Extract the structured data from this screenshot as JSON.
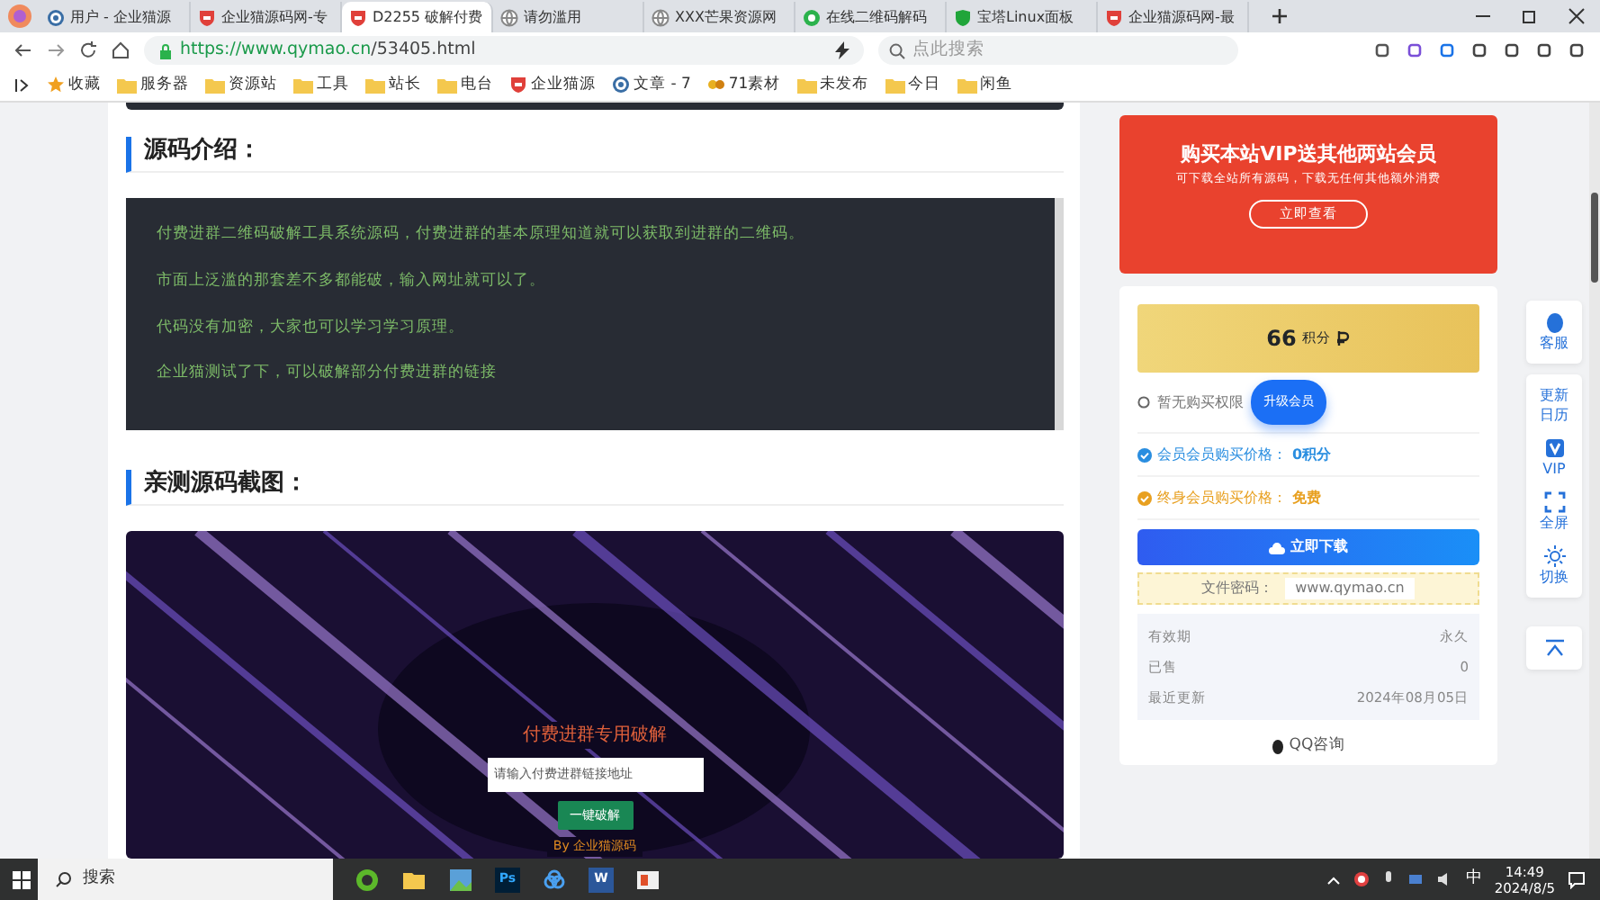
{
  "tabs": [
    {
      "title": "用户 - 企业猫源",
      "kind": "wp",
      "selected": false
    },
    {
      "title": "企业猫源码网-专",
      "kind": "red",
      "selected": false
    },
    {
      "title": "D2255 破解付费",
      "kind": "red",
      "selected": true
    },
    {
      "title": "请勿滥用",
      "kind": "globe",
      "selected": false
    },
    {
      "title": "XXX芒果资源网",
      "kind": "globe",
      "selected": false
    },
    {
      "title": "在线二维码解码",
      "kind": "green",
      "selected": false
    },
    {
      "title": "宝塔Linux面板",
      "kind": "shield",
      "selected": false
    },
    {
      "title": "企业猫源码网-最",
      "kind": "red",
      "selected": false
    }
  ],
  "address": {
    "url_host": "https://www.qymao.cn",
    "url_path": "/53405.html",
    "search_placeholder": "点此搜索"
  },
  "bookmarks": [
    {
      "label": "收藏",
      "kind": "star"
    },
    {
      "label": "服务器",
      "kind": "folder"
    },
    {
      "label": "资源站",
      "kind": "folder"
    },
    {
      "label": "工具",
      "kind": "folder"
    },
    {
      "label": "站长",
      "kind": "folder"
    },
    {
      "label": "电台",
      "kind": "folder"
    },
    {
      "label": "企业猫源",
      "kind": "red"
    },
    {
      "label": "文章 - 7",
      "kind": "wp"
    },
    {
      "label": "71素材",
      "kind": "site"
    },
    {
      "label": "未发布",
      "kind": "folder"
    },
    {
      "label": "今日",
      "kind": "folder"
    },
    {
      "label": "闲鱼",
      "kind": "folder"
    }
  ],
  "article": {
    "intro_heading": "源码介绍：",
    "paragraphs": [
      "付费进群二维码破解工具系统源码，付费进群的基本原理知道就可以获取到进群的二维码。",
      "市面上泛滥的那套差不多都能破，输入网址就可以了。",
      "代码没有加密，大家也可以学习学习原理。",
      "企业猫测试了下，可以破解部分付费进群的链接"
    ],
    "screenshot_heading": "亲测源码截图：",
    "screenshot": {
      "title": "付费进群专用破解",
      "input_placeholder": "请输入付费进群链接地址",
      "button": "一键破解",
      "footer": "By 企业猫源码"
    }
  },
  "sidebar": {
    "promo": {
      "title": "购买本站VIP送其他两站会员",
      "subtitle": "可下载全站所有源码，下载无任何其他额外消费",
      "button": "立即查看"
    },
    "price": {
      "points": "66",
      "unit": "积分"
    },
    "no_access": "暂无购买权限",
    "upgrade_button": "升级会员",
    "prices": [
      {
        "label": "会员会员购买价格：",
        "value": "0积分",
        "kind": "member"
      },
      {
        "label": "终身会员购买价格：",
        "value": "免费",
        "kind": "lifetime"
      }
    ],
    "download_button": "立即下载",
    "password": {
      "label": "文件密码：",
      "value": "www.qymao.cn"
    },
    "info": [
      {
        "label": "有效期",
        "value": "永久"
      },
      {
        "label": "已售",
        "value": "0"
      },
      {
        "label": "最近更新",
        "value": "2024年08月05日"
      }
    ],
    "qq": "QQ咨询"
  },
  "float_toolbar": [
    {
      "label": "客服",
      "kind": "qq"
    },
    {
      "label": "更新日历",
      "kind": "text"
    },
    {
      "label": "VIP",
      "kind": "vip"
    },
    {
      "label": "全屏",
      "kind": "fullscreen"
    },
    {
      "label": "切换",
      "kind": "theme"
    },
    {
      "kind": "top"
    }
  ],
  "taskbar": {
    "search": "搜索",
    "apps": [
      {
        "kind": "edge"
      },
      {
        "kind": "folder"
      },
      {
        "kind": "photos"
      },
      {
        "kind": "ps",
        "label": "Ps"
      },
      {
        "kind": "cloud"
      },
      {
        "kind": "word",
        "label": "W"
      },
      {
        "kind": "slides"
      }
    ],
    "ime": "中",
    "time": "14:49",
    "date": "2024/8/5"
  }
}
